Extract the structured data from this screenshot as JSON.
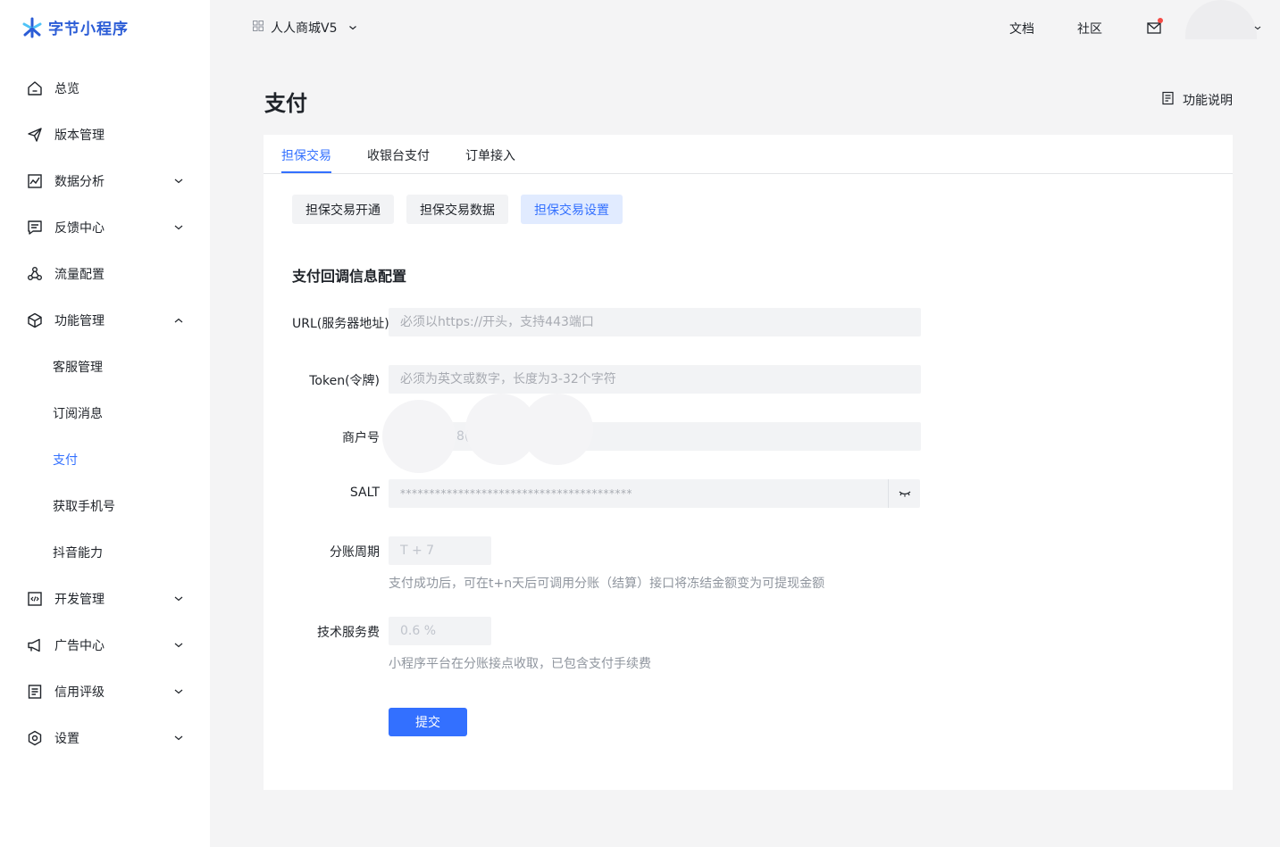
{
  "brand": {
    "name": "字节小程序",
    "color": "#2b5cd6"
  },
  "sidebar": {
    "items": [
      {
        "label": "总览",
        "icon": "home-icon",
        "expandable": false
      },
      {
        "label": "版本管理",
        "icon": "send-icon",
        "expandable": false
      },
      {
        "label": "数据分析",
        "icon": "chart-icon",
        "expandable": true
      },
      {
        "label": "反馈中心",
        "icon": "message-icon",
        "expandable": true
      },
      {
        "label": "流量配置",
        "icon": "network-icon",
        "expandable": false
      },
      {
        "label": "功能管理",
        "icon": "cube-icon",
        "expandable": true,
        "expanded": true
      },
      {
        "label": "开发管理",
        "icon": "code-icon",
        "expandable": true
      },
      {
        "label": "广告中心",
        "icon": "megaphone-icon",
        "expandable": true
      },
      {
        "label": "信用评级",
        "icon": "document-icon",
        "expandable": true
      },
      {
        "label": "设置",
        "icon": "gear-icon",
        "expandable": true
      }
    ],
    "sub_items": [
      {
        "label": "客服管理",
        "active": false
      },
      {
        "label": "订阅消息",
        "active": false
      },
      {
        "label": "支付",
        "active": true
      },
      {
        "label": "获取手机号",
        "active": false
      },
      {
        "label": "抖音能力",
        "active": false
      }
    ]
  },
  "topbar": {
    "app_name": "人人商城V5",
    "docs": "文档",
    "community": "社区"
  },
  "page": {
    "title": "支付",
    "func_desc": "功能说明"
  },
  "tabs": [
    {
      "label": "担保交易",
      "active": true
    },
    {
      "label": "收银台支付",
      "active": false
    },
    {
      "label": "订单接入",
      "active": false
    }
  ],
  "segments": [
    {
      "label": "担保交易开通",
      "active": false
    },
    {
      "label": "担保交易数据",
      "active": false
    },
    {
      "label": "担保交易设置",
      "active": true
    }
  ],
  "form": {
    "section_title": "支付回调信息配置",
    "url": {
      "label": "URL(服务器地址)",
      "placeholder": "必须以https://开头，支持443端口",
      "value": ""
    },
    "token": {
      "label": "Token(令牌)",
      "placeholder": "必须为英文或数字，长度为3-32个字符",
      "value": ""
    },
    "merchant": {
      "label": "商户号",
      "value": "8("
    },
    "salt": {
      "label": "SALT",
      "value": "****************************************"
    },
    "settle_cycle": {
      "label": "分账周期",
      "value": "T + 7",
      "hint": "支付成功后，可在t+n天后可调用分账（结算）接口将冻结金额变为可提现金额"
    },
    "service_fee": {
      "label": "技术服务费",
      "value": "0.6 %",
      "hint": "小程序平台在分账接点收取，已包含支付手续费"
    },
    "submit": "提交"
  },
  "colors": {
    "accent": "#3370ff",
    "notification": "#f54a45"
  }
}
